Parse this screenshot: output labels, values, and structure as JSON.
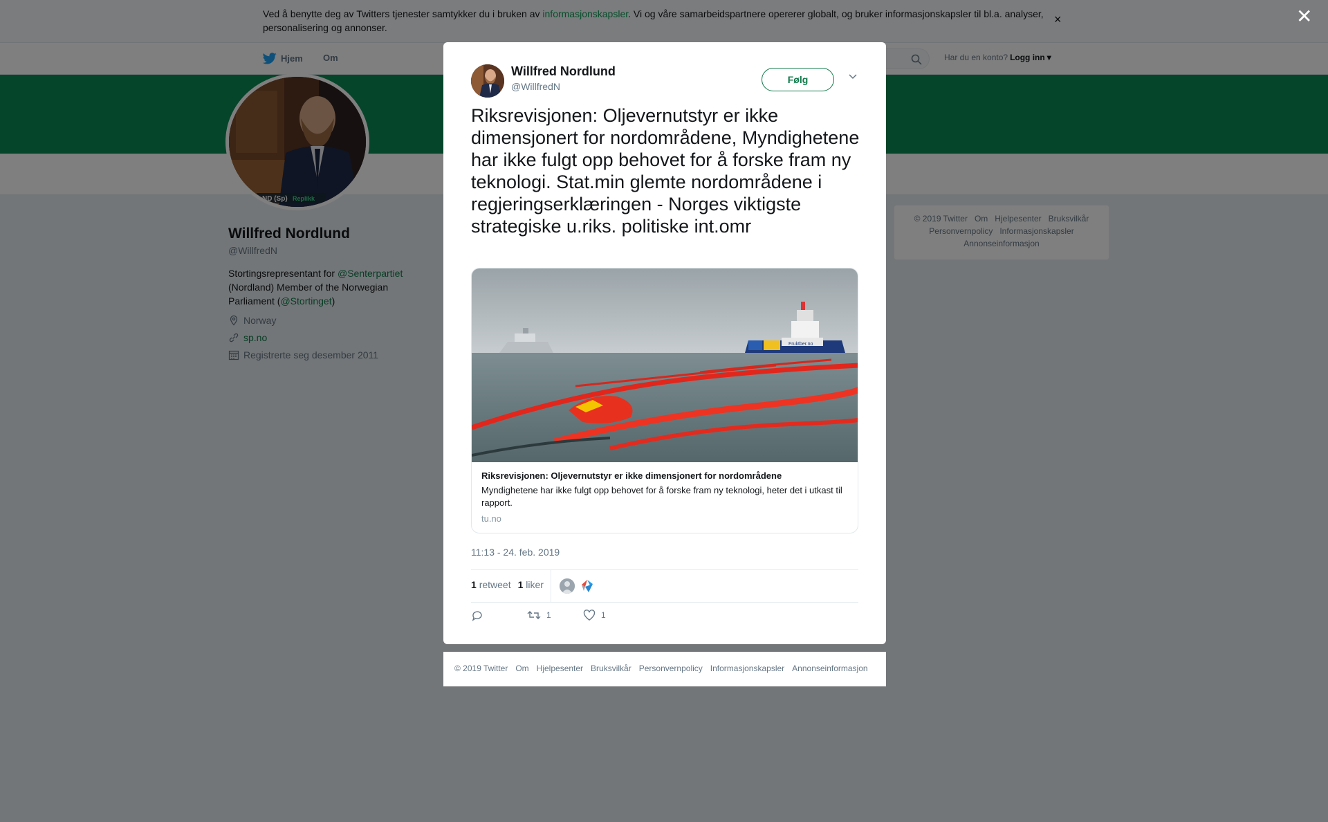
{
  "cookie_banner": {
    "text_before": "Ved å benytte deg av Twitters tjenester samtykker du i bruken av ",
    "link": "informasjonskapsler",
    "text_after": ". Vi og våre samarbeidspartnere opererer globalt, og bruker informasjonskapsler til bl.a. analyser, personalisering og annonser.",
    "close": "×"
  },
  "nav": {
    "home": "Hjem",
    "about": "Om",
    "login_prompt": "Har du en konto?",
    "login": "Logg inn",
    "login_caret": "▾"
  },
  "profile": {
    "name": "Willfred Nordlund",
    "handle": "@WillfredN",
    "bio_1": "Stortingsrepresentant for ",
    "bio_link_1": "@Senterpartiet",
    "bio_2": " (Nordland) Member of the Norwegian Parliament (",
    "bio_link_2": "@Stortinget",
    "bio_3": ")",
    "location": "Norway",
    "website": "sp.no",
    "joined": "Registrerte seg desember 2011",
    "photo_caption": "ND (Sp)",
    "photo_caption_2": "Replikk"
  },
  "side_footer": {
    "row1": [
      "© 2019 Twitter",
      "Om",
      "Hjelpesenter",
      "Bruksvilkår"
    ],
    "row2": [
      "Personvernpolicy",
      "Informasjonskapsler"
    ],
    "row3": [
      "Annonseinformasjon"
    ]
  },
  "overlay": {
    "close": "✕"
  },
  "tweet": {
    "author_name": "Willfred Nordlund",
    "author_handle": "@WillfredN",
    "follow_label": "Følg",
    "text": "Riksrevisjonen: Oljevernutstyr er ikke dimensjonert for nordområdene, Myndighetene har ikke fulgt opp behovet for å forske fram ny teknologi. Stat.min glemte nordområdene i regjeringserklæringen - Norges viktigste strategiske u.riks. politiske int.omr",
    "card": {
      "title": "Riksrevisjonen: Oljevernutstyr er ikke dimensjonert for nordområdene",
      "description": "Myndighetene har ikke fulgt opp behovet for å forske fram ny teknologi, heter det i utkast til rapport.",
      "domain": "tu.no",
      "image_text": "Fruktber.no"
    },
    "timestamp": "11:13 - 24. feb. 2019",
    "retweets_count": "1",
    "retweets_label": "retweet",
    "likes_count": "1",
    "likes_label": "liker",
    "action_retweet_count": "1",
    "action_like_count": "1"
  },
  "modal_footer": [
    "© 2019 Twitter",
    "Om",
    "Hjelpesenter",
    "Bruksvilkår",
    "Personvernpolicy",
    "Informasjonskapsler",
    "Annonseinformasjon"
  ],
  "colors": {
    "brand_green": "#0a8a55",
    "link_green": "#0f7a4a",
    "twitter_blue": "#1da1f2"
  },
  "icons": [
    "twitter-bird-icon",
    "search-icon",
    "location-pin-icon",
    "link-icon",
    "calendar-icon",
    "close-icon",
    "chevron-down-icon",
    "reply-icon",
    "retweet-icon",
    "heart-icon"
  ]
}
